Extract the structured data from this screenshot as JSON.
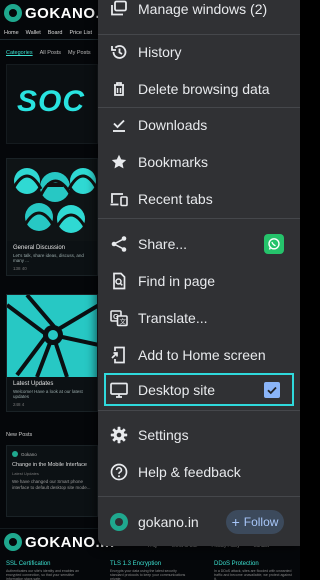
{
  "page": {
    "site_logo_text": "GOKANO.in",
    "nav": [
      "Home",
      "Wallet",
      "Board",
      "Price List"
    ],
    "tabs": [
      "Categories",
      "All Posts",
      "My Posts"
    ],
    "hero_text": "SOC",
    "cards": [
      {
        "title": "General Discussion",
        "desc": "Let's talk, share ideas, discuss, and many ...",
        "meta": "138  40"
      },
      {
        "title": "Latest Updates",
        "desc": "Welcome! Have a look at our latest updates",
        "meta": "248  4"
      }
    ],
    "new_posts_label": "New Posts",
    "post": {
      "author": "Gokano",
      "title": "Change in the Mobile Interface",
      "category": "Latest Updates",
      "excerpt": "We have changed our Smart phone interface to default desktop site mode..."
    },
    "footer": {
      "logo_text": "GOKANO.in",
      "links": [
        "FAQ",
        "Terms of Use",
        "Privacy Policy",
        "Contact"
      ],
      "columns": [
        {
          "title": "SSL Certification",
          "text": "Authenticates our site's identity and enables an encrypted connection, so that your sensitive information stays safe."
        },
        {
          "title": "TLS 1.3 Encryption",
          "text": "Encrypts your data using the latest security standard protocols to keep your communications private."
        },
        {
          "title": "DDoS Protection",
          "text": "In a DDoS attack, sites are flooded with unwanted traffic and become unavailable, we protect against it."
        }
      ]
    }
  },
  "menu": {
    "items": [
      {
        "id": "manage-windows",
        "label": "Manage windows (2)",
        "icon": "windows-icon"
      },
      {
        "id": "history",
        "label": "History",
        "icon": "history-icon"
      },
      {
        "id": "delete-browsing-data",
        "label": "Delete browsing data",
        "icon": "trash-icon"
      },
      {
        "id": "downloads",
        "label": "Downloads",
        "icon": "download-check-icon"
      },
      {
        "id": "bookmarks",
        "label": "Bookmarks",
        "icon": "star-icon"
      },
      {
        "id": "recent-tabs",
        "label": "Recent tabs",
        "icon": "devices-icon"
      },
      {
        "id": "share",
        "label": "Share...",
        "icon": "share-icon"
      },
      {
        "id": "find-in-page",
        "label": "Find in page",
        "icon": "find-in-page-icon"
      },
      {
        "id": "translate",
        "label": "Translate...",
        "icon": "translate-icon"
      },
      {
        "id": "add-to-home-screen",
        "label": "Add to Home screen",
        "icon": "add-to-home-icon"
      },
      {
        "id": "desktop-site",
        "label": "Desktop site",
        "icon": "monitor-icon",
        "checked": true
      },
      {
        "id": "settings",
        "label": "Settings",
        "icon": "gear-icon"
      },
      {
        "id": "help-feedback",
        "label": "Help & feedback",
        "icon": "help-icon"
      }
    ],
    "share_app_icon": "whatsapp-icon",
    "site_name": "gokano.in",
    "follow_label": "Follow",
    "highlight_color": "#2fd9dc"
  }
}
